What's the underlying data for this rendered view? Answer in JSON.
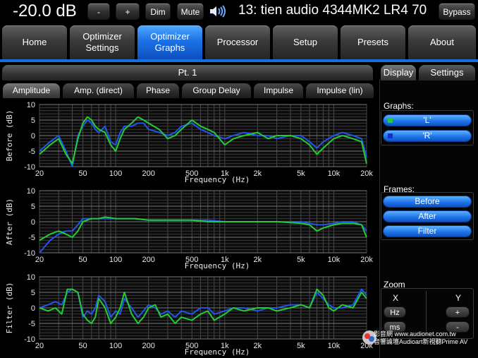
{
  "topbar": {
    "volume": "-20.0 dB",
    "minus_label": "-",
    "plus_label": "+",
    "dim_label": "Dim",
    "mute_label": "Mute",
    "speaker_icon": "speaker-icon",
    "preset_title": "13: tien audio 4344MK2 LR4 70",
    "bypass_label": "Bypass"
  },
  "tabs": [
    {
      "label": "Home"
    },
    {
      "label": "Optimizer\nSettings"
    },
    {
      "label": "Optimizer\nGraphs",
      "active": true
    },
    {
      "label": "Processor"
    },
    {
      "label": "Setup"
    },
    {
      "label": "Presets"
    },
    {
      "label": "About"
    }
  ],
  "point_header": "Pt. 1",
  "subtabs": [
    "Amplitude",
    "Amp. (direct)",
    "Phase",
    "Group Delay",
    "Impulse",
    "Impulse (lin)"
  ],
  "active_subtab": "Amplitude",
  "panel_tabs": [
    "Display",
    "Settings"
  ],
  "graphs_section": {
    "label": "Graphs:",
    "items": [
      {
        "label": "'L'",
        "color": "#22cc33"
      },
      {
        "label": "'R'",
        "color": "#2255ee"
      }
    ]
  },
  "frames_section": {
    "label": "Frames:",
    "items": [
      "Before",
      "After",
      "Filter"
    ]
  },
  "zoom_section": {
    "label": "Zoom",
    "x_label": "X",
    "y_label": "Y",
    "x_buttons": [
      "Hz",
      "ms"
    ],
    "y_buttons": [
      "+",
      "-"
    ]
  },
  "watermark": {
    "line1": "音響論壇Audioart新視聽Prime AV",
    "line2": "www.audionet.com.tw",
    "brand": "影音網"
  },
  "colors": {
    "accent": "#1a6fe0",
    "series_L": "#22cc33",
    "series_R": "#2255ee"
  },
  "chart_data": [
    {
      "type": "line",
      "ylabel": "Before (dB)",
      "xlabel": "Frequency (Hz)",
      "xscale": "log",
      "xlim": [
        20,
        20000
      ],
      "ylim": [
        -10,
        10
      ],
      "yticks": [
        10,
        5,
        0,
        -5,
        -10
      ],
      "xticks": [
        "20",
        "50",
        "100",
        "200",
        "500",
        "1k",
        "2k",
        "5k",
        "10k",
        "20k"
      ],
      "xtick_values": [
        20,
        50,
        100,
        200,
        500,
        1000,
        2000,
        5000,
        10000,
        20000
      ],
      "grid": true,
      "series": [
        {
          "name": "'L'",
          "color": "#22cc33",
          "x": [
            20,
            25,
            30,
            35,
            40,
            45,
            50,
            55,
            60,
            65,
            70,
            80,
            90,
            100,
            110,
            120,
            140,
            160,
            180,
            200,
            250,
            300,
            350,
            400,
            500,
            600,
            700,
            800,
            1000,
            1200,
            1500,
            2000,
            2500,
            3000,
            4000,
            5000,
            6000,
            7000,
            8000,
            10000,
            12000,
            15000,
            18000,
            20000
          ],
          "y": [
            -6,
            -3,
            -1,
            -6,
            -9,
            -1,
            4,
            6,
            5,
            3,
            2,
            1,
            -3,
            -5,
            -1,
            2,
            4,
            6,
            5,
            4,
            2,
            -1,
            0,
            2,
            5,
            3,
            2,
            1,
            -3,
            -1,
            0,
            1,
            -1,
            0,
            0,
            -1,
            -3,
            -6,
            -4,
            -1,
            0,
            -1,
            -2,
            -9
          ]
        },
        {
          "name": "'R'",
          "color": "#2255ee",
          "x": [
            20,
            25,
            30,
            35,
            40,
            45,
            50,
            55,
            60,
            65,
            70,
            80,
            90,
            100,
            110,
            120,
            140,
            160,
            180,
            200,
            250,
            300,
            350,
            400,
            500,
            600,
            700,
            800,
            1000,
            1200,
            1500,
            2000,
            2500,
            3000,
            4000,
            5000,
            6000,
            7000,
            8000,
            10000,
            12000,
            15000,
            18000,
            20000
          ],
          "y": [
            -5,
            -2,
            0,
            -5,
            -10,
            0,
            3,
            5,
            4,
            2,
            1,
            3,
            -2,
            -3,
            1,
            3,
            3,
            4,
            4,
            2,
            1,
            0,
            1,
            3,
            4,
            2,
            1,
            0,
            -1,
            0,
            1,
            0,
            0,
            -1,
            0,
            0,
            -2,
            -4,
            -2,
            0,
            1,
            0,
            -1,
            -7
          ]
        }
      ]
    },
    {
      "type": "line",
      "ylabel": "After (dB)",
      "xlabel": "Frequency (Hz)",
      "xscale": "log",
      "xlim": [
        20,
        20000
      ],
      "ylim": [
        -10,
        10
      ],
      "yticks": [
        10,
        5,
        0,
        -5,
        -10
      ],
      "xticks": [
        "20",
        "50",
        "100",
        "200",
        "500",
        "1k",
        "2k",
        "5k",
        "10k",
        "20k"
      ],
      "xtick_values": [
        20,
        50,
        100,
        200,
        500,
        1000,
        2000,
        5000,
        10000,
        20000
      ],
      "grid": true,
      "series": [
        {
          "name": "'L'",
          "color": "#22cc33",
          "x": [
            20,
            25,
            30,
            35,
            40,
            45,
            50,
            60,
            70,
            80,
            100,
            120,
            150,
            200,
            300,
            500,
            700,
            1000,
            1500,
            2000,
            3000,
            5000,
            6000,
            7000,
            8000,
            10000,
            12000,
            15000,
            18000,
            20000
          ],
          "y": [
            -6,
            -4,
            -3,
            -4,
            -5,
            -3,
            0,
            1,
            1,
            1.5,
            1,
            1,
            1,
            0.5,
            0.5,
            0.5,
            0,
            0,
            0,
            0,
            0,
            -0.5,
            -1,
            -3,
            -2,
            -1,
            -0.5,
            -0.5,
            -1,
            -5
          ]
        },
        {
          "name": "'R'",
          "color": "#2255ee",
          "x": [
            20,
            25,
            30,
            35,
            40,
            45,
            50,
            60,
            70,
            80,
            100,
            120,
            150,
            200,
            300,
            500,
            700,
            1000,
            1500,
            2000,
            3000,
            5000,
            6000,
            7000,
            8000,
            10000,
            12000,
            15000,
            18000,
            20000
          ],
          "y": [
            -10,
            -6,
            -4,
            -3,
            -3,
            -1,
            1,
            1,
            1,
            1,
            1,
            1,
            1,
            0.5,
            0.5,
            0.5,
            0.5,
            0,
            0,
            0,
            0,
            0,
            -0.5,
            -1,
            -1,
            -0.5,
            0,
            0,
            -1,
            -3
          ]
        }
      ]
    },
    {
      "type": "line",
      "ylabel": "Filter (dB)",
      "xlabel": "Frequency (Hz)",
      "xscale": "log",
      "xlim": [
        20,
        20000
      ],
      "ylim": [
        -10,
        10
      ],
      "yticks": [
        10,
        5,
        0,
        -5,
        -10
      ],
      "xticks": [
        "20",
        "50",
        "100",
        "200",
        "500",
        "1k",
        "2k",
        "5k",
        "10k",
        "20k"
      ],
      "xtick_values": [
        20,
        50,
        100,
        200,
        500,
        1000,
        2000,
        5000,
        10000,
        20000
      ],
      "grid": true,
      "series": [
        {
          "name": "'L'",
          "color": "#22cc33",
          "x": [
            20,
            24,
            28,
            32,
            36,
            40,
            45,
            50,
            55,
            60,
            65,
            70,
            80,
            90,
            100,
            110,
            120,
            140,
            160,
            180,
            200,
            230,
            260,
            300,
            350,
            400,
            500,
            600,
            700,
            800,
            1000,
            1200,
            1500,
            2000,
            2500,
            3000,
            4000,
            5000,
            6000,
            7000,
            8000,
            9000,
            10000,
            12000,
            15000,
            18000,
            20000
          ],
          "y": [
            0,
            -1,
            0,
            -2,
            6,
            6,
            5,
            -2,
            -4,
            -5,
            -3,
            3,
            0,
            -5,
            -3,
            0,
            5,
            -2,
            -5,
            -3,
            0,
            1,
            -3,
            -2,
            -5,
            -3,
            -4,
            -2,
            -1,
            -4,
            -2,
            0,
            -1,
            0,
            0,
            -1,
            0,
            1,
            0,
            6,
            4,
            0,
            -1,
            1,
            0,
            5,
            3
          ]
        },
        {
          "name": "'R'",
          "color": "#2255ee",
          "x": [
            20,
            24,
            28,
            32,
            36,
            40,
            45,
            50,
            55,
            60,
            65,
            70,
            80,
            90,
            100,
            110,
            120,
            140,
            160,
            180,
            200,
            230,
            260,
            300,
            350,
            400,
            500,
            600,
            700,
            800,
            1000,
            1200,
            1500,
            2000,
            2500,
            3000,
            4000,
            5000,
            6000,
            7000,
            8000,
            9000,
            10000,
            12000,
            15000,
            18000,
            20000
          ],
          "y": [
            0,
            1,
            2,
            1,
            5,
            6,
            5,
            -3,
            -1,
            -2,
            0,
            4,
            2,
            -3,
            -1,
            -2,
            3,
            0,
            -3,
            -1,
            1,
            0,
            -2,
            -1,
            -3,
            -1,
            -2,
            0,
            0,
            -2,
            -1,
            0,
            0,
            -1,
            0,
            0,
            1,
            1,
            0,
            5,
            3,
            1,
            0,
            0,
            1,
            6,
            4
          ]
        }
      ]
    }
  ]
}
